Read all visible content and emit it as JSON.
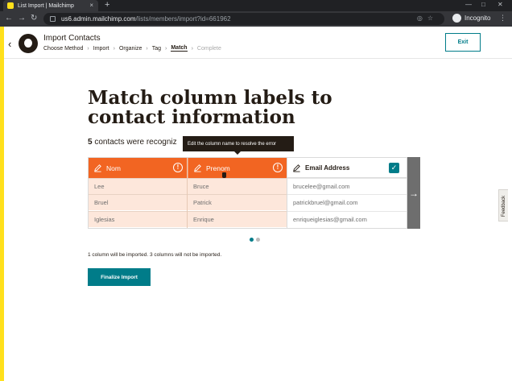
{
  "browser": {
    "tab_title": "List Import | Mailchimp",
    "tab_close": "×",
    "new_tab": "+",
    "url_host": "us6.admin.mailchimp.com",
    "url_path": "/lists/members/import?id=661962",
    "profile_label": "Incognito",
    "nav_icons": [
      "back-arrow-icon",
      "forward-arrow-icon",
      "reload-icon"
    ],
    "omnibox_icons": [
      "eye-slash-icon",
      "star-icon"
    ]
  },
  "header": {
    "back_icon": "chevron-left-icon",
    "title": "Import Contacts",
    "steps": [
      {
        "label": "Choose Method",
        "state": "done"
      },
      {
        "label": "Import",
        "state": "done"
      },
      {
        "label": "Organize",
        "state": "done"
      },
      {
        "label": "Tag",
        "state": "done"
      },
      {
        "label": "Match",
        "state": "active"
      },
      {
        "label": "Complete",
        "state": "pending"
      }
    ],
    "step_separator": "›",
    "exit_label": "Exit"
  },
  "main": {
    "heading": "Match column labels to contact information",
    "count_number": "5",
    "count_text": " contacts were recogniz",
    "tooltip": "Edit the column name to resolve the error",
    "columns": [
      {
        "label": "Nom",
        "status": "error",
        "cells": [
          "Lee",
          "Bruel",
          "Iglesias"
        ]
      },
      {
        "label": "Prenom",
        "status": "error",
        "cells": [
          "Bruce",
          "Patrick",
          "Enrique"
        ]
      },
      {
        "label": "Email Address",
        "status": "matched",
        "cells": [
          "brucelee@gmail.com",
          "patrickbruel@gmail.com",
          "enriqueiglesias@gmail.com"
        ]
      }
    ],
    "warning_glyph": "!",
    "check_glyph": "✓",
    "next_arrow": "→",
    "pagination": {
      "current": 1,
      "total": 2
    },
    "summary": "1 column will be imported. 3 columns will not be imported.",
    "finalize_label": "Finalize Import"
  },
  "feedback_label": "Feedback",
  "colors": {
    "brand_yellow": "#ffe01b",
    "error_orange": "#f26522",
    "error_row_bg": "#fde7db",
    "teal": "#007c89",
    "dark": "#241c15"
  }
}
